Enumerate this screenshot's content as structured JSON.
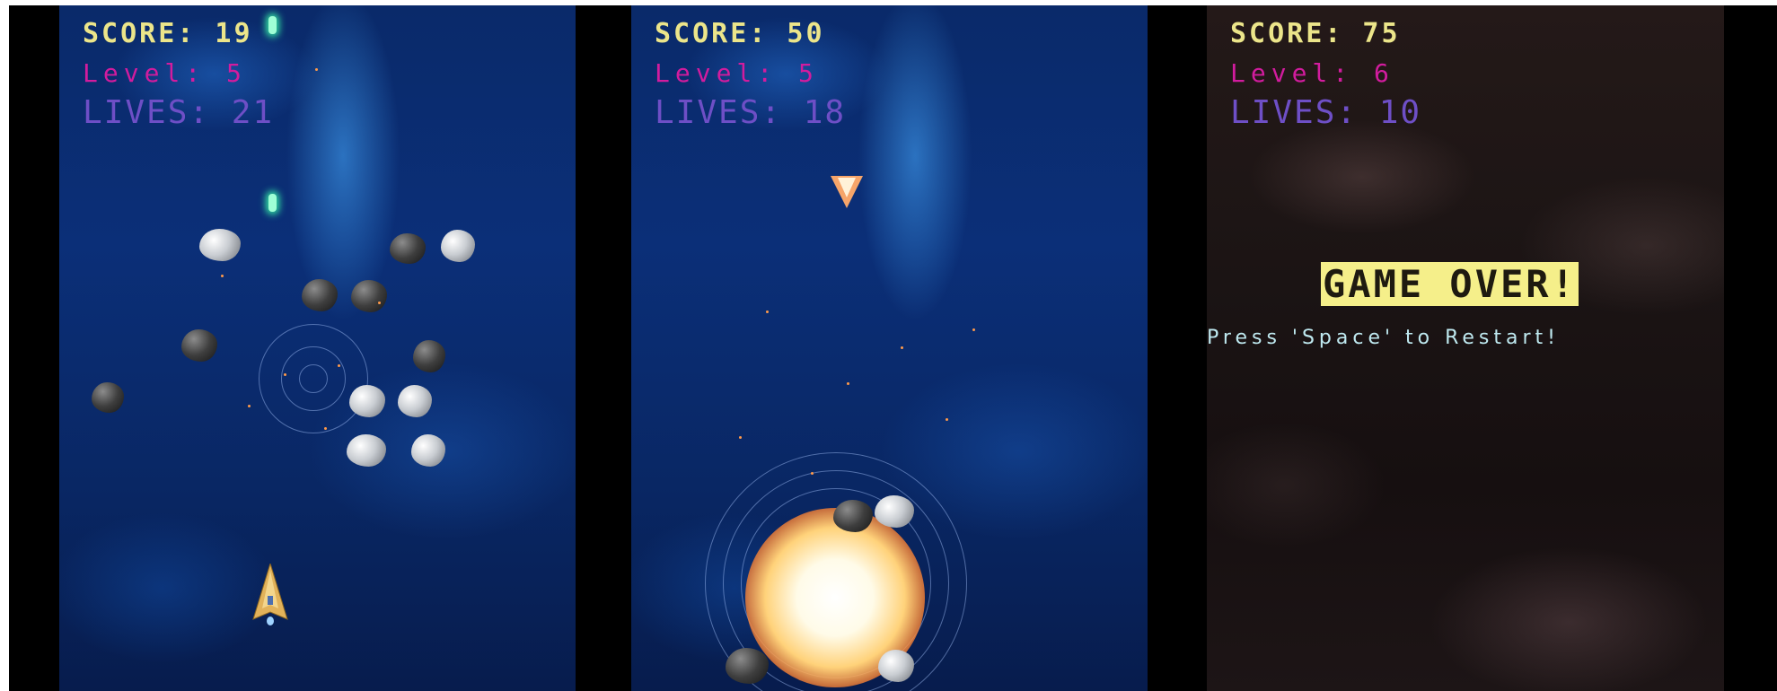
{
  "panels": [
    {
      "score": "SCORE: 19",
      "level": "Level: 5",
      "lives": "LIVES: 21"
    },
    {
      "score": "SCORE: 50",
      "level": "Level: 5",
      "lives": "LIVES: 18"
    },
    {
      "score": "SCORE: 75",
      "level": "Level: 6",
      "lives": "LIVES: 10",
      "game_over": "GAME OVER!",
      "restart_prompt": "Press 'Space' to Restart!"
    }
  ],
  "colors": {
    "score": "#ece58a",
    "level": "#d21c9e",
    "lives": "#6e4fc6",
    "game_over_bg": "#f5ef8a",
    "restart": "#bfe9f0"
  },
  "icons": [
    "player-ship-icon",
    "asteroid-icon",
    "laser-bolt-icon",
    "enemy-ship-icon",
    "explosion-icon"
  ]
}
